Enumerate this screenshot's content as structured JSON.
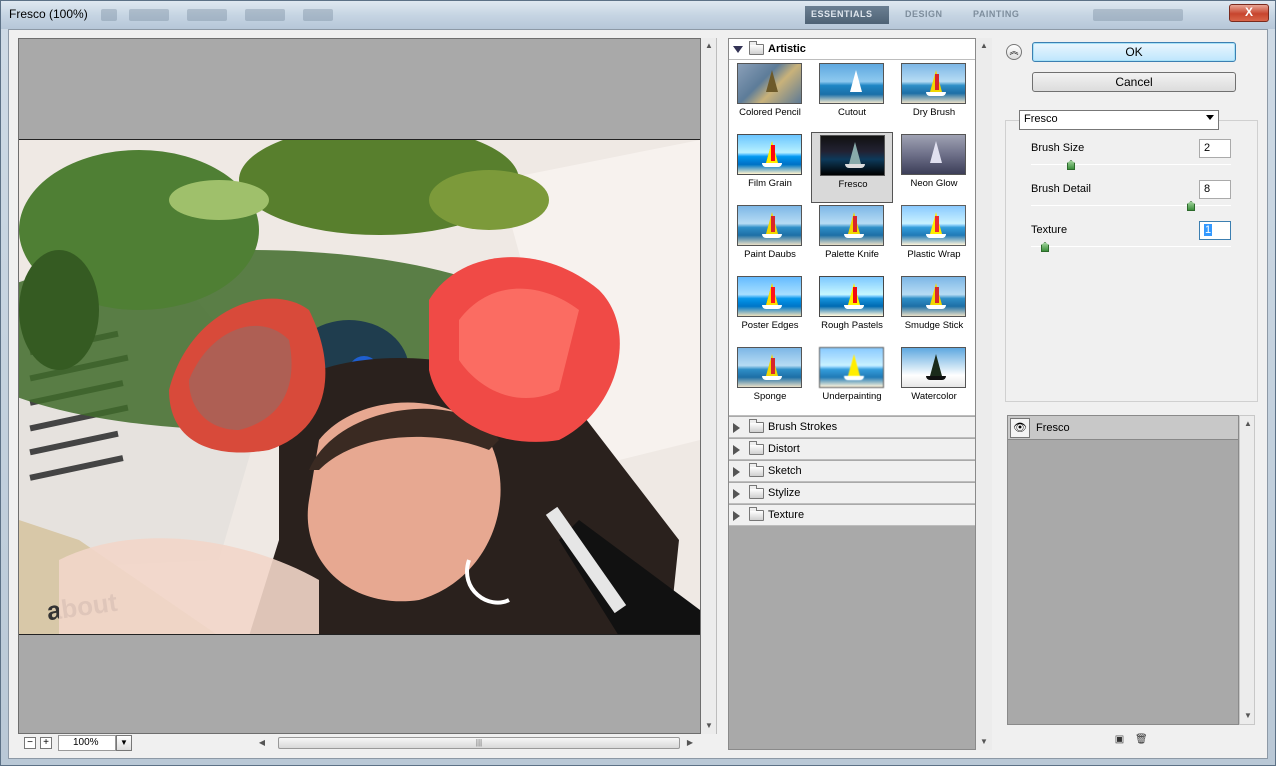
{
  "window": {
    "title": "Fresco (100%)",
    "close_label": "X"
  },
  "workspace_tabs": [
    "ESSENTIALS",
    "DESIGN",
    "PAINTING"
  ],
  "preview": {
    "zoom_value": "100%",
    "zoom_minus": "−",
    "zoom_plus": "+",
    "photo_caption": "about"
  },
  "gallery": {
    "open_category": "Artistic",
    "filters": [
      "Colored Pencil",
      "Cutout",
      "Dry Brush",
      "Film Grain",
      "Fresco",
      "Neon Glow",
      "Paint Daubs",
      "Palette Knife",
      "Plastic Wrap",
      "Poster Edges",
      "Rough Pastels",
      "Smudge Stick",
      "Sponge",
      "Underpainting",
      "Watercolor"
    ],
    "selected_filter": "Fresco",
    "collapsed_categories": [
      "Brush Strokes",
      "Distort",
      "Sketch",
      "Stylize",
      "Texture"
    ]
  },
  "buttons": {
    "ok": "OK",
    "cancel": "Cancel"
  },
  "options": {
    "filter_select": "Fresco",
    "params": [
      {
        "label": "Brush Size",
        "value": "2",
        "slider": 0.2
      },
      {
        "label": "Brush Detail",
        "value": "8",
        "slider": 0.8
      },
      {
        "label": "Texture",
        "value": "1",
        "slider": 0.07
      }
    ]
  },
  "layers": {
    "items": [
      {
        "name": "Fresco"
      }
    ]
  },
  "colors": {
    "accent": "#3c7fb1",
    "selection": "#3399ff",
    "panel": "#a9a9a9"
  }
}
